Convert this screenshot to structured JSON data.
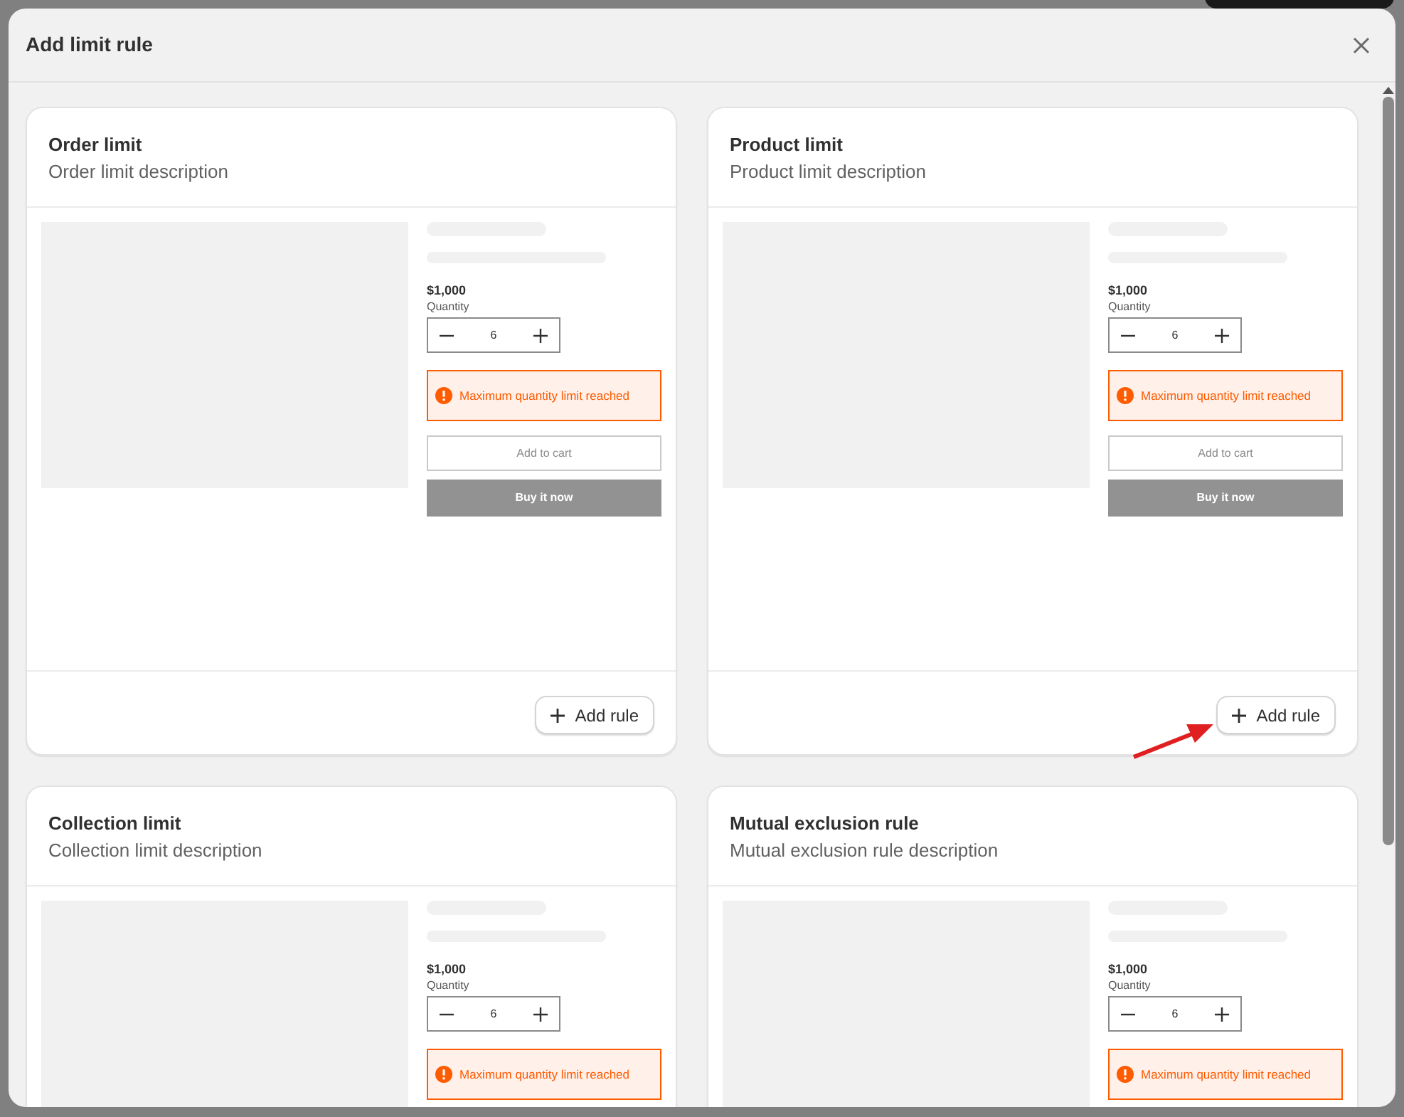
{
  "modal": {
    "title": "Add limit rule"
  },
  "cards": [
    {
      "title": "Order limit",
      "description": "Order limit description",
      "price": "$1,000",
      "quantity_label": "Quantity",
      "quantity": "6",
      "warning": "Maximum quantity limit reached",
      "add_to_cart": "Add to cart",
      "buy_now": "Buy it now",
      "add_rule": "Add rule",
      "highlighted": false
    },
    {
      "title": "Product limit",
      "description": "Product limit description",
      "price": "$1,000",
      "quantity_label": "Quantity",
      "quantity": "6",
      "warning": "Maximum quantity limit reached",
      "add_to_cart": "Add to cart",
      "buy_now": "Buy it now",
      "add_rule": "Add rule",
      "highlighted": true
    },
    {
      "title": "Collection limit",
      "description": "Collection limit description",
      "price": "$1,000",
      "quantity_label": "Quantity",
      "quantity": "6",
      "warning": "Maximum quantity limit reached",
      "highlighted": false
    },
    {
      "title": "Mutual exclusion rule",
      "description": "Mutual exclusion rule description",
      "price": "$1,000",
      "quantity_label": "Quantity",
      "quantity": "6",
      "warning": "Maximum quantity limit reached",
      "highlighted": false
    }
  ]
}
